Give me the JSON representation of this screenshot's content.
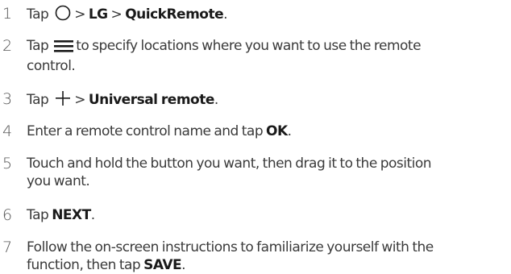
{
  "steps": [
    {
      "num": "1",
      "parts": {
        "a": "Tap",
        "b": "> ",
        "c": "LG",
        "d": " > ",
        "e": "QuickRemote",
        "f": "."
      },
      "icon": "home-circle-icon"
    },
    {
      "num": "2",
      "parts": {
        "a": "Tap",
        "b": "to specify locations where you want to use the remote",
        "c": "control."
      },
      "icon": "menu-lines-icon"
    },
    {
      "num": "3",
      "parts": {
        "a": "Tap",
        "b": "> ",
        "c": "Universal remote",
        "d": "."
      },
      "icon": "plus-icon"
    },
    {
      "num": "4",
      "parts": {
        "a": "Enter a remote control name and tap ",
        "b": "OK",
        "c": "."
      }
    },
    {
      "num": "5",
      "parts": {
        "a": "Touch and hold the button you want, then drag it to the position",
        "b": "you want."
      }
    },
    {
      "num": "6",
      "parts": {
        "a": "Tap ",
        "b": "NEXT",
        "c": "."
      }
    },
    {
      "num": "7",
      "parts": {
        "a": "Follow the on-screen instructions to familiarize yourself with the",
        "b": "function, then tap ",
        "c": "SAVE",
        "d": "."
      }
    }
  ]
}
